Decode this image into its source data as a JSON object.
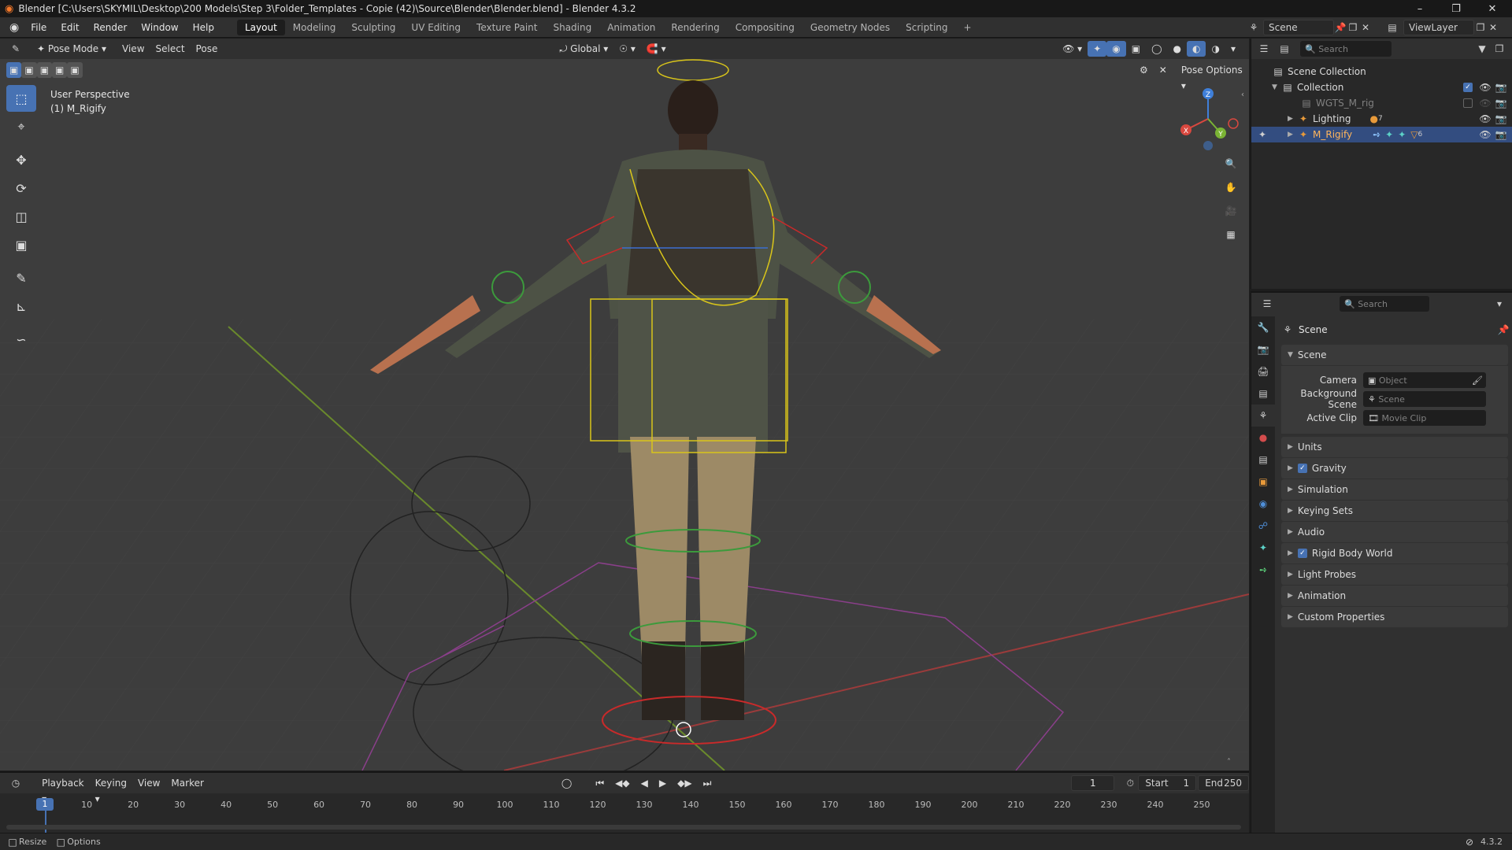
{
  "window": {
    "title": "Blender [C:\\Users\\SKYMIL\\Desktop\\200 Models\\Step 3\\Folder_Templates - Copie (42)\\Source\\Blender\\Blender.blend] - Blender 4.3.2",
    "minimize": "–",
    "maximize": "❐",
    "close": "✕"
  },
  "menubar": {
    "menus": [
      "File",
      "Edit",
      "Render",
      "Window",
      "Help"
    ],
    "workspaces": [
      "Layout",
      "Modeling",
      "Sculpting",
      "UV Editing",
      "Texture Paint",
      "Shading",
      "Animation",
      "Rendering",
      "Compositing",
      "Geometry Nodes",
      "Scripting"
    ],
    "active_workspace": "Layout",
    "add_workspace": "+",
    "scene_name": "Scene",
    "view_layer": "ViewLayer"
  },
  "viewport_header": {
    "mode": "Pose Mode",
    "menus": [
      "View",
      "Select",
      "Pose"
    ],
    "orientation": "Global",
    "pose_options": "Pose Options"
  },
  "viewport": {
    "perspective_label": "User Perspective",
    "object_label": "(1) M_Rigify",
    "gizmo_axes": [
      "X",
      "Y",
      "Z"
    ]
  },
  "tools": [
    "select-box",
    "cursor",
    "move",
    "rotate",
    "scale",
    "transform",
    "annotate",
    "measure",
    "bone-roll"
  ],
  "outliner": {
    "search_placeholder": "Search",
    "items": [
      {
        "label": "Scene Collection",
        "level": 0
      },
      {
        "label": "Collection",
        "level": 1
      },
      {
        "label": "WGTS_M_rig",
        "level": 2
      },
      {
        "label": "Lighting",
        "level": 2,
        "badge": "7"
      },
      {
        "label": "M_Rigify",
        "level": 2,
        "badge": "6",
        "selected": true
      }
    ]
  },
  "properties": {
    "search_placeholder": "Search",
    "context": "Scene",
    "panel_title": "Scene",
    "fields": [
      {
        "label": "Camera",
        "placeholder": "Object"
      },
      {
        "label": "Background Scene",
        "placeholder": "Scene"
      },
      {
        "label": "Active Clip",
        "placeholder": "Movie Clip"
      }
    ],
    "sections": [
      {
        "label": "Units",
        "checkbox": false
      },
      {
        "label": "Gravity",
        "checkbox": true
      },
      {
        "label": "Simulation",
        "checkbox": false
      },
      {
        "label": "Keying Sets",
        "checkbox": false
      },
      {
        "label": "Audio",
        "checkbox": false
      },
      {
        "label": "Rigid Body World",
        "checkbox": true
      },
      {
        "label": "Light Probes",
        "checkbox": false
      },
      {
        "label": "Animation",
        "checkbox": false
      },
      {
        "label": "Custom Properties",
        "checkbox": false
      }
    ]
  },
  "timeline": {
    "menus": [
      "Playback",
      "Keying",
      "View",
      "Marker"
    ],
    "current_frame": "1",
    "start_label": "Start",
    "start": "1",
    "end_label": "End",
    "end": "250",
    "ruler": [
      "10",
      "20",
      "30",
      "40",
      "50",
      "60",
      "70",
      "80",
      "90",
      "100",
      "110",
      "120",
      "130",
      "140",
      "150",
      "160",
      "170",
      "180",
      "190",
      "200",
      "210",
      "220",
      "230",
      "240",
      "250"
    ]
  },
  "statusbar": {
    "resize": "Resize",
    "options": "Options",
    "version": "4.3.2"
  },
  "colors": {
    "accent": "#4772b3",
    "viewport_bg": "#3d3d3d",
    "panel_bg": "#303030",
    "selected_row": "#334d80"
  }
}
